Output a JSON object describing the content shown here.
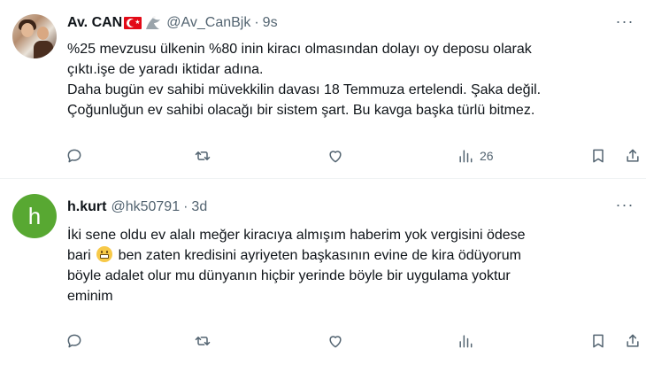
{
  "tweets": [
    {
      "author": "Av. CAN",
      "handle": "@Av_CanBjk",
      "separator": "·",
      "time": "9s",
      "more": "···",
      "lines": [
        "%25 mevzusu ülkenin %80 inin kiracı olmasından dolayı oy deposu olarak",
        "çıktı.işe de yaradı iktidar adına.",
        "Daha bugün ev sahibi müvekkilin davası 18 Temmuza ertelendi. Şaka değil.",
        "Çoğunluğun ev sahibi olacağı bir sistem şart. Bu kavga başka türlü bitmez."
      ],
      "views": "26"
    },
    {
      "author": "h.kurt",
      "handle": "@hk50791",
      "separator": "·",
      "time": "3d",
      "more": "···",
      "avatar_letter": "h",
      "lines": [
        "İki sene oldu ev alalı meğer kiracıya almışım haberim yok vergisini ödese",
        "bari",
        "ben zaten kredisini ayriyeten başkasının evine de kira ödüyorum",
        "böyle adalet olur mu dünyanın hiçbir yerinde böyle bir uygulama yoktur",
        "eminim"
      ],
      "views": ""
    }
  ],
  "icons": {
    "reply": "reply-icon",
    "retweet": "retweet-icon",
    "like": "like-icon",
    "views": "views-icon",
    "bookmark": "bookmark-icon",
    "share": "share-icon",
    "flag": "turkish-flag-icon",
    "eagle": "eagle-icon",
    "emoji": "grimacing-face-emoji"
  },
  "colors": {
    "text": "#0f1419",
    "secondary": "#536471",
    "divider": "#eff3f4",
    "avatar_h": "#58a832"
  }
}
